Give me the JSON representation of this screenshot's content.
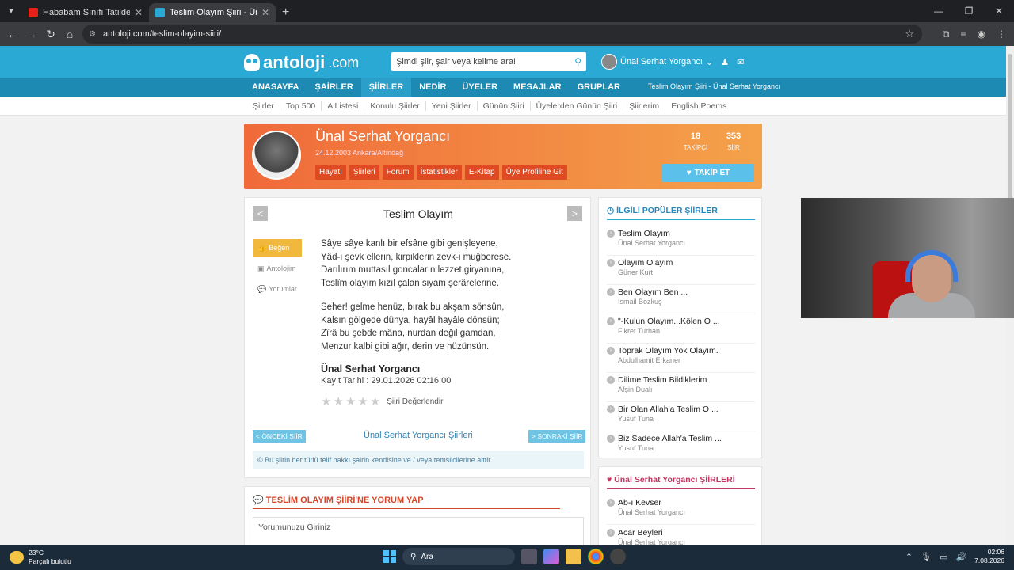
{
  "browser": {
    "tabs": [
      {
        "title": "Hababam Sınıfı Tatilde | Full HD",
        "close": "✕",
        "color": "#e62117"
      },
      {
        "title": "Teslim Olayım Şiiri - Ünal Serhat",
        "close": "✕",
        "color": "#29a9d4"
      }
    ],
    "new_tab": "+",
    "url": "antoloji.com/teslim-olayim-siiri/",
    "window_controls": [
      "—",
      "❐",
      "✕"
    ]
  },
  "site": {
    "logo": "antoloji",
    "logo_suffix": ".com",
    "search_placeholder": "Şimdi şiir, şair veya kelime ara!",
    "user_name": "Ünal Serhat Yorgancı",
    "nav": [
      "ANASAYFA",
      "ŞAİRLER",
      "ŞİİRLER",
      "NEDİR",
      "ÜYELER",
      "MESAJLAR",
      "GRUPLAR"
    ],
    "nav_active": "ŞİİRLER",
    "breadcrumb": "Teslim Olayım Şiiri - Ünal Serhat Yorgancı",
    "subnav": [
      "Şiirler",
      "Top 500",
      "A Listesi",
      "Konulu Şiirler",
      "Yeni Şiirler",
      "Günün Şiiri",
      "Üyelerden Günün Şiiri",
      "Şiirlerim",
      "English Poems"
    ]
  },
  "profile": {
    "name": "Ünal Serhat Yorgancı",
    "meta": "24.12.2003 Ankara/Altındağ",
    "tabs": [
      "Hayatı",
      "Şiirleri",
      "Forum",
      "İstatistikler",
      "E-Kitap",
      "Üye Profiline Git"
    ],
    "followers_count": "18",
    "followers_label": "TAKİPÇİ",
    "poems_count": "353",
    "poems_label": "ŞİİR",
    "follow_button": "TAKİP ET"
  },
  "poem": {
    "title": "Teslim Olayım",
    "prev_arrow": "<",
    "next_arrow": ">",
    "actions": {
      "like": "Beğen",
      "antoloji": "Antolojim",
      "comments": "Yorumlar"
    },
    "stanza1": [
      "Sâye sâye kanlı bir efsâne gibi genişleyene,",
      "Yâd-ı şevk ellerin, kirpiklerin zevk-i muğberese.",
      "Darılırım muttasıl goncaların lezzet giryanına,",
      "Teslîm olayım kızıl çalan siyam şerârelerine."
    ],
    "stanza2": [
      "Seher! gelme henüz, bırak bu akşam sönsün,",
      "Kalsın gölgede dünya, hayâl hayâle dönsün;",
      "Zîrâ bu şebde mâna, nurdan değil gamdan,",
      "Menzur kalbi gibi ağır, derin ve hüzünsün."
    ],
    "author": "Ünal Serhat Yorgancı",
    "date": "Kayıt Tarihi : 29.01.2026 02:16:00",
    "rating_label": "Şiiri Değerlendir",
    "rating": 0,
    "prev_button": "< ÖNCEKİ ŞİİR",
    "next_button": "> SONRAKİ ŞİİR",
    "author_poems_link": "Ünal Serhat Yorgancı Şiirleri",
    "copyright": "© Bu şiirin her türlü telif hakkı şairin kendisine ve / veya temsilcilerine aittir."
  },
  "comment": {
    "title": "TESLİM OLAYIM ŞİİRİ'NE YORUM YAP",
    "placeholder": "Yorumunuzu Giriniz"
  },
  "related": {
    "title": "İLGİLİ POPÜLER ŞİİRLER",
    "items": [
      {
        "title": "Teslim Olayım",
        "author": "Ünal Serhat Yorgancı"
      },
      {
        "title": "Olayım Olayım",
        "author": "Güner Kurt"
      },
      {
        "title": "Ben Olayım Ben ...",
        "author": "İsmail Bozkuş"
      },
      {
        "title": "\"-Kulun Olayım...Kölen O ...",
        "author": "Fikret Turhan"
      },
      {
        "title": "Toprak Olayım Yok Olayım.",
        "author": "Abdulhamit Erkaner"
      },
      {
        "title": "Dilime Teslim Bildiklerim",
        "author": "Afşin Dualı"
      },
      {
        "title": "Bir Olan Allah'a Teslim O ...",
        "author": "Yusuf Tuna"
      },
      {
        "title": "Biz Sadece Allah'a Teslim ...",
        "author": "Yusuf Tuna"
      }
    ]
  },
  "author_poems": {
    "title": "Ünal Serhat Yorgancı ŞİİRLERİ",
    "items": [
      {
        "title": "Ab-ı Kevser",
        "author": "Ünal Serhat Yorgancı"
      },
      {
        "title": "Acar Beyleri",
        "author": "Ünal Serhat Yorgancı"
      }
    ]
  },
  "taskbar": {
    "temp": "23°C",
    "weather": "Parçalı bulutlu",
    "search": "Ara",
    "time": "02:06",
    "date": "7.08.2026"
  },
  "colors": {
    "header": "#29a9d4",
    "nav": "#1c8ab3",
    "accent_orange": "#f06a3a",
    "like": "#f0b83c"
  }
}
